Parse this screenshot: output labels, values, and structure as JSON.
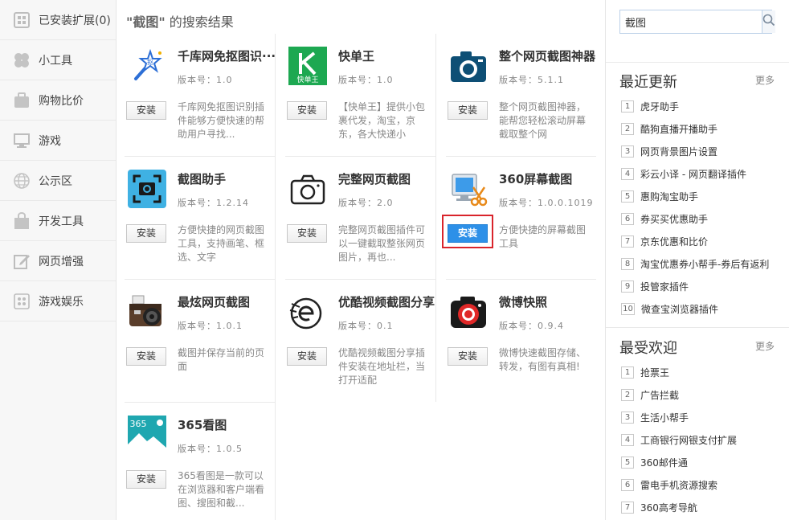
{
  "sidebar": {
    "items": [
      {
        "label": "已安装扩展(0)",
        "icon": "installed-icon"
      },
      {
        "label": "小工具",
        "icon": "tools-icon"
      },
      {
        "label": "购物比价",
        "icon": "shopping-icon"
      },
      {
        "label": "游戏",
        "icon": "monitor-icon"
      },
      {
        "label": "公示区",
        "icon": "globe-icon"
      },
      {
        "label": "开发工具",
        "icon": "bag-icon"
      },
      {
        "label": "网页增强",
        "icon": "edit-icon"
      },
      {
        "label": "游戏娱乐",
        "icon": "grid-icon"
      }
    ]
  },
  "results": {
    "query": "\"截图\"",
    "suffix": " 的搜索结果"
  },
  "extensions": [
    {
      "name": "千库网免抠图识···",
      "version": "版本号：1.0",
      "install": "安装",
      "desc": "千库网免抠图识别插件能够方便快速的帮助用户寻找...",
      "icon": "magic-wand-icon",
      "highlight": false
    },
    {
      "name": "快单王",
      "version": "版本号：1.0",
      "install": "安装",
      "desc": "【快单王】提供小包裹代发，淘宝，京东，各大快递小",
      "icon": "kuaidanwang-logo-icon",
      "highlight": false
    },
    {
      "name": "整个网页截图神器",
      "version": "版本号：5.1.1",
      "install": "安装",
      "desc": "整个网页截图神器，能帮您轻松滚动屏幕截取整个网",
      "icon": "camera-icon",
      "highlight": false
    },
    {
      "name": "截图助手",
      "version": "版本号：1.2.14",
      "install": "安装",
      "desc": "方便快捷的网页截图工具，支持画笔、框选、文字",
      "icon": "screenshot-frame-icon",
      "highlight": false
    },
    {
      "name": "完整网页截图",
      "version": "版本号：2.0",
      "install": "安装",
      "desc": "完整网页截图插件可以一键截取整张网页图片，再也...",
      "icon": "camera-outline-icon",
      "highlight": false
    },
    {
      "name": "360屏幕截图",
      "version": "版本号：1.0.0.1019",
      "install": "安装",
      "desc": "方便快捷的屏幕截图工具",
      "icon": "screen-scissors-icon",
      "highlight": true
    },
    {
      "name": "最炫网页截图",
      "version": "版本号：1.0.1",
      "install": "安装",
      "desc": "截图并保存当前的页面",
      "icon": "retro-camera-icon",
      "highlight": false
    },
    {
      "name": "优酷视频截图分享",
      "version": "版本号：0.1",
      "install": "安装",
      "desc": "优酷视频截图分享插件安装在地址栏，当打开适配",
      "icon": "youku-logo-icon",
      "highlight": false
    },
    {
      "name": "微博快照",
      "version": "版本号：0.9.4",
      "install": "安装",
      "desc": "微博快速截图存储、转发，有图有真相!",
      "icon": "weibo-camera-icon",
      "highlight": false
    },
    {
      "name": "365看图",
      "version": "版本号：1.0.5",
      "install": "安装",
      "desc": "365看图是一款可以在浏览器和客户端看图、搜图和截...",
      "icon": "365-viewer-icon",
      "highlight": false
    }
  ],
  "search": {
    "value": "截图"
  },
  "recent": {
    "title": "最近更新",
    "more": "更多",
    "items": [
      "虎牙助手",
      "酷狗直播开播助手",
      "网页背景图片设置",
      "彩云小译 - 网页翻译插件",
      "惠购淘宝助手",
      "券买买优惠助手",
      "京东优惠和比价",
      "淘宝优惠券小帮手-券后有返利",
      "投管家插件",
      "微查宝浏览器插件"
    ],
    "nums": [
      "1",
      "2",
      "3",
      "4",
      "5",
      "6",
      "7",
      "8",
      "9",
      "10"
    ]
  },
  "popular": {
    "title": "最受欢迎",
    "more": "更多",
    "items": [
      "抢票王",
      "广告拦截",
      "生活小帮手",
      "工商银行网银支付扩展",
      "360邮件通",
      "雷电手机资源搜索",
      "360高考导航"
    ],
    "nums": [
      "1",
      "2",
      "3",
      "4",
      "5",
      "6",
      "7"
    ]
  },
  "colors": {
    "accent": "#2d90e8",
    "highlight_border": "#d9242b"
  }
}
